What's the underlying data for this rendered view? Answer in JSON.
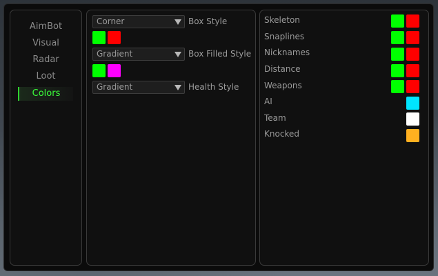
{
  "sidebar": {
    "items": [
      {
        "label": "AimBot"
      },
      {
        "label": "Visual"
      },
      {
        "label": "Radar"
      },
      {
        "label": "Loot"
      },
      {
        "label": "Colors"
      }
    ],
    "active": "Colors"
  },
  "middle": {
    "box_style": {
      "value": "Corner",
      "label": "Box Style",
      "colors": [
        "#00ff00",
        "#ff0000"
      ]
    },
    "box_filled_style": {
      "value": "Gradient",
      "label": "Box Filled Style",
      "colors": [
        "#00ff00",
        "#ff00ff"
      ]
    },
    "health_style": {
      "value": "Gradient",
      "label": "Health Style"
    }
  },
  "right": {
    "rows": [
      {
        "label": "Skeleton",
        "colors": [
          "#00ff00",
          "#ff0000"
        ]
      },
      {
        "label": "Snaplines",
        "colors": [
          "#00ff00",
          "#ff0000"
        ]
      },
      {
        "label": "Nicknames",
        "colors": [
          "#00ff00",
          "#ff0000"
        ]
      },
      {
        "label": "Distance",
        "colors": [
          "#00ff00",
          "#ff0000"
        ]
      },
      {
        "label": "Weapons",
        "colors": [
          "#00ff00",
          "#ff0000"
        ]
      },
      {
        "label": "AI",
        "colors": [
          "#00e5ff"
        ]
      },
      {
        "label": "Team",
        "colors": [
          "#ffffff"
        ]
      },
      {
        "label": "Knocked",
        "colors": [
          "#ffb020"
        ]
      }
    ]
  },
  "theme": {
    "accent": "#3bff3b",
    "panel_bg": "#101010",
    "text": "#9a9a9a"
  }
}
